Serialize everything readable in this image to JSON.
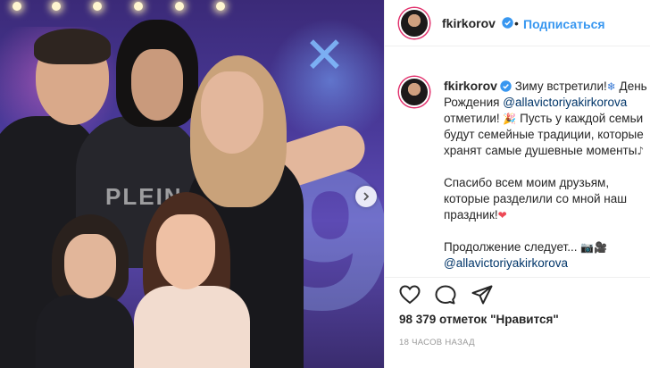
{
  "post": {
    "username": "fkirkorov",
    "follow_label": "Подписаться",
    "separator": "•",
    "caption": {
      "line1a": "Зиму встретили!",
      "line1b": " День",
      "line2a": "Рождения ",
      "mention1": "@allavictoriyakirkorova",
      "line3": "отметили!",
      "line3b": " Пусть у каждой семьи",
      "line4": "будут семейные традиции, которые",
      "line5": "хранят самые душевные моменты",
      "para2": "Спасибо всем моим друзьям,\nкоторые разделили со мной наш\nпраздник!",
      "para3": "Продолжение следует...",
      "mention2": "@allavictoriyakirkorova"
    },
    "likes_text": "98 379 отметок \"Нравится\"",
    "time_ago": "18 ЧАСОВ НАЗАД"
  },
  "photo": {
    "text_on_shirt": "PLEIN"
  },
  "icons": {
    "verified": "verified-badge-icon",
    "like": "heart-icon",
    "comment": "comment-icon",
    "share": "share-icon",
    "next": "chevron-right-icon"
  },
  "colors": {
    "accent_link": "#3897f0",
    "mention": "#003569",
    "verified": "#3897f0",
    "heart_emoji": "#ed4956"
  }
}
